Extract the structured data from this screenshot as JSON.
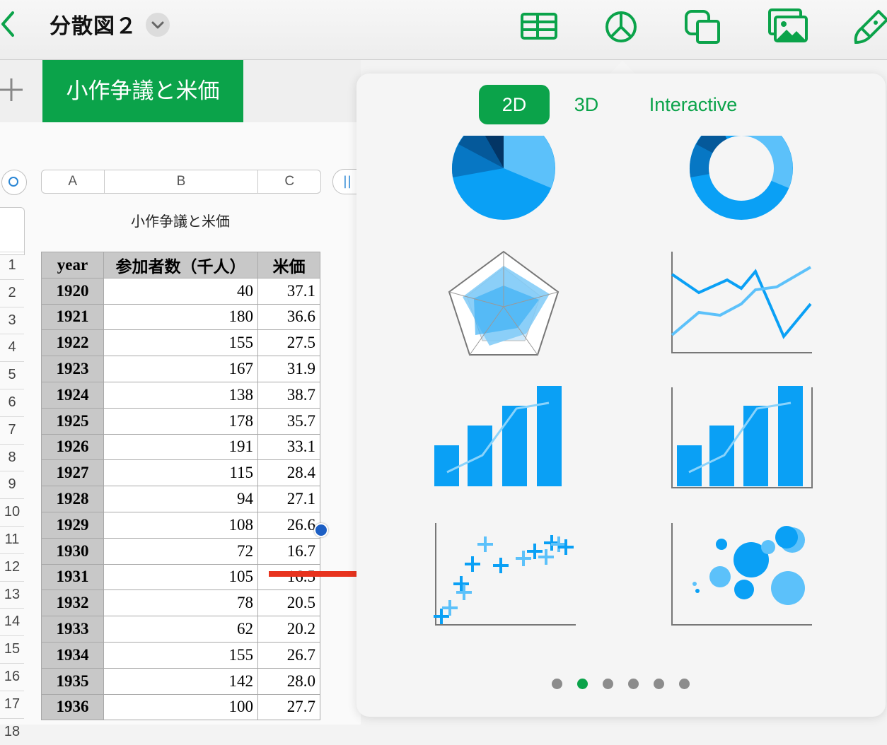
{
  "toolbar": {
    "back_icon": "chevron-left-icon",
    "doc_title": "分散図２",
    "accent_color": "#0ba34a",
    "icons": [
      "table-icon",
      "chart-icon",
      "shapes-icon",
      "media-icon",
      "format-brush-icon"
    ]
  },
  "tabs": {
    "add_icon": "plus-icon",
    "sheet_name": "小作争議と米価"
  },
  "sheet": {
    "column_headers": [
      "A",
      "B",
      "C"
    ],
    "table_title": "小作争議と米価",
    "headers": [
      "year",
      "参加者数（千人）",
      "米価"
    ],
    "row_numbers": [
      "1",
      "2",
      "3",
      "4",
      "5",
      "6",
      "7",
      "8",
      "9",
      "10",
      "11",
      "12",
      "13",
      "14",
      "15",
      "16",
      "17",
      "18"
    ],
    "rows": [
      [
        "1920",
        "40",
        "37.1"
      ],
      [
        "1921",
        "180",
        "36.6"
      ],
      [
        "1922",
        "155",
        "27.5"
      ],
      [
        "1923",
        "167",
        "31.9"
      ],
      [
        "1924",
        "138",
        "38.7"
      ],
      [
        "1925",
        "178",
        "35.7"
      ],
      [
        "1926",
        "191",
        "33.1"
      ],
      [
        "1927",
        "115",
        "28.4"
      ],
      [
        "1928",
        "94",
        "27.1"
      ],
      [
        "1929",
        "108",
        "26.6"
      ],
      [
        "1930",
        "72",
        "16.7"
      ],
      [
        "1931",
        "105",
        "16.5"
      ],
      [
        "1932",
        "78",
        "20.5"
      ],
      [
        "1933",
        "62",
        "20.2"
      ],
      [
        "1934",
        "155",
        "26.7"
      ],
      [
        "1935",
        "142",
        "28.0"
      ],
      [
        "1936",
        "100",
        "27.7"
      ]
    ]
  },
  "popover": {
    "segments": [
      "2D",
      "3D",
      "Interactive"
    ],
    "active_segment": "2D",
    "chart_types": [
      "pie",
      "donut",
      "radar",
      "line",
      "bar-line",
      "bar-line-axes",
      "scatter",
      "bubble"
    ],
    "page_count": 6,
    "active_page": 2,
    "chart_blue": "#0aa0f5"
  }
}
